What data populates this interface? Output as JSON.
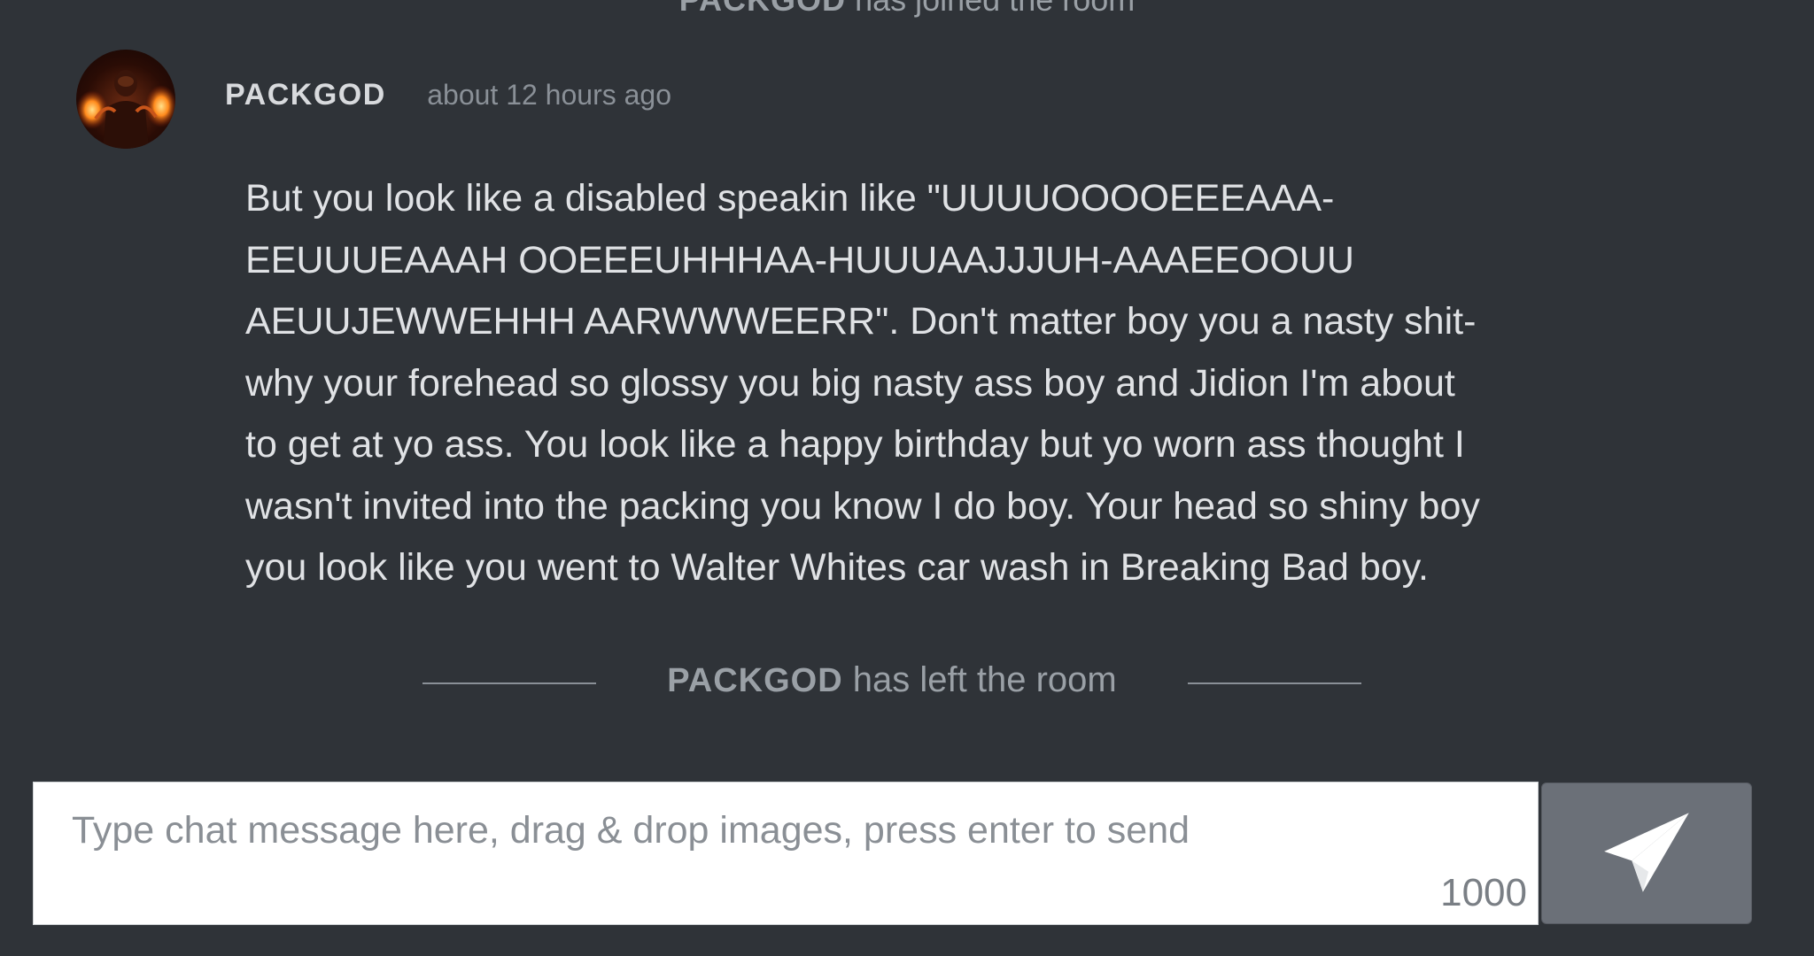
{
  "top_system": {
    "user": "PACKGOD",
    "text": "has joined the room"
  },
  "message": {
    "username": "PACKGOD",
    "timestamp": "about 12 hours ago",
    "avatar": "avatar-image",
    "lines": [
      "But you look like a disabled speakin like \"UUUUOOOOEEEAAA-",
      "EEUUUEAAAH OOEEEUHHHAA-HUUUAAJJJUH-AAAEEOOUU",
      "AEUUJEWWEHHH AARWWWEERR\". Don't matter boy you a nasty shit-",
      "why your forehead so glossy you big nasty ass boy and Jidion I'm about",
      "to get at yo ass. You look like a happy birthday but yo worn ass thought I",
      "wasn't invited into the packing you know I do boy. Your head so shiny boy",
      "you look like you went to Walter Whites car wash in Breaking Bad boy."
    ]
  },
  "left_system": {
    "user": "PACKGOD",
    "text": "has left the room"
  },
  "composer": {
    "placeholder": "Type chat message here, drag & drop images, press enter to send",
    "char_count": "1000",
    "send_icon": "paper-plane-icon"
  },
  "colors": {
    "background": "#2f3338",
    "send_button": "#6b7078"
  }
}
